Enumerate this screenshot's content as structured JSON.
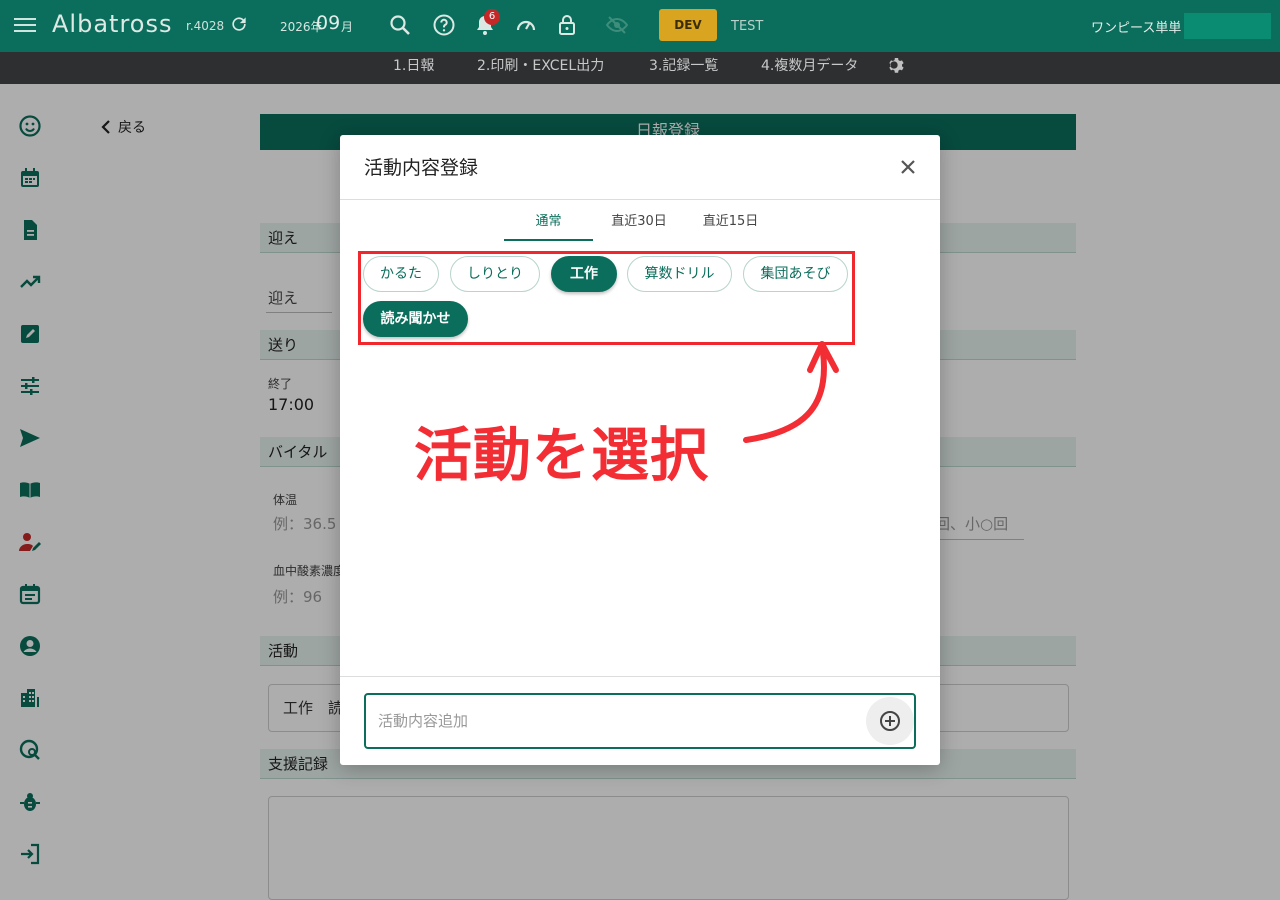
{
  "topbar": {
    "brand": "Albatross",
    "revision": "r.4028",
    "year_label": "2026年",
    "month_value": "09",
    "month_suffix": "月",
    "notification_count": "6",
    "env_badge": "DEV",
    "env_label": "TEST",
    "user_name": "ワンピース単単",
    "bg_color": "#0b6e5c",
    "env_badge_color": "#d9a521"
  },
  "subnav": {
    "items": [
      "1.日報",
      "2.印刷・EXCEL出力",
      "3.記録一覧",
      "4.複数月データ"
    ]
  },
  "sidebar": {
    "icons": [
      "smiley-icon",
      "calendar-icon",
      "document-icon",
      "trending-up-icon",
      "edit-note-icon",
      "sliders-icon",
      "send-icon",
      "book-icon",
      "user-edit-icon",
      "event-icon",
      "account-circle-icon",
      "building-icon",
      "search-location-icon",
      "bug-icon",
      "logout-icon"
    ]
  },
  "page": {
    "back_label": "戻る",
    "header_title": "日報登録",
    "sections": {
      "pickup": "迎え",
      "pickup_field": "迎え",
      "dropoff": "送り",
      "end_label": "終了",
      "end_time": "17:00",
      "vital": "バイタル",
      "temp_label": "体温",
      "temp_placeholder": "例：36.5",
      "excretion_placeholder": "回、小○回",
      "spo2_label": "血中酸素濃度",
      "spo2_placeholder": "例：96",
      "activity": "活動",
      "activity_value": "工作　読",
      "support": "支援記録"
    }
  },
  "modal": {
    "title": "活動内容登録",
    "tabs": [
      "通常",
      "直近30日",
      "直近15日"
    ],
    "active_tab": "通常",
    "chips": [
      {
        "label": "かるた",
        "selected": false
      },
      {
        "label": "しりとり",
        "selected": false
      },
      {
        "label": "工作",
        "selected": true
      },
      {
        "label": "算数ドリル",
        "selected": false
      },
      {
        "label": "集団あそび",
        "selected": false
      },
      {
        "label": "読み聞かせ",
        "selected": true
      }
    ],
    "add_placeholder": "活動内容追加"
  },
  "annotation": {
    "text": "活動を選択",
    "color": "#f22d33"
  }
}
